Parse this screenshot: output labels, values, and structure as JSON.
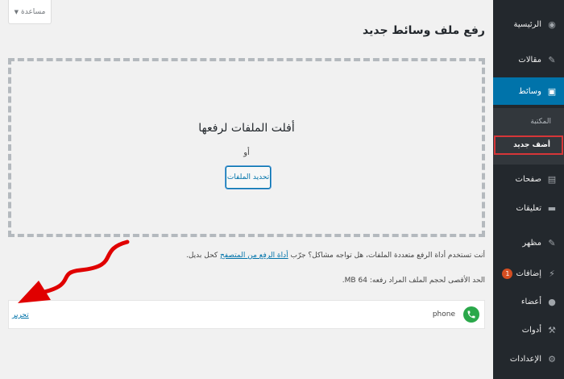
{
  "help": {
    "label": "مساعدة"
  },
  "page": {
    "title": "رفع ملف وسائط جديد"
  },
  "uploader": {
    "drop_title": "أفلت الملفات لرفعها",
    "or_text": "أو",
    "select_button": "تحديد الملفات"
  },
  "note": {
    "prefix": "أنت تستخدم أداة الرفع متعددة الملفات، هل تواجه مشاكل؟ جرّب ",
    "link": "أداة الرفع من المتصفح",
    "suffix": " كحل بديل."
  },
  "max_size": {
    "text": "الحد الأقصى لحجم الملف المراد رفعه: 64 MB."
  },
  "media_item": {
    "filename": "phone",
    "edit_label": "تحرير"
  },
  "sidebar": {
    "items": [
      {
        "label": "الرئيسية",
        "icon": "dashboard-icon"
      },
      {
        "label": "مقالات",
        "icon": "pin-icon"
      },
      {
        "label": "وسائط",
        "icon": "media-icon"
      },
      {
        "label": "صفحات",
        "icon": "pages-icon"
      },
      {
        "label": "تعليقات",
        "icon": "comments-icon"
      },
      {
        "label": "مظهر",
        "icon": "appearance-icon"
      },
      {
        "label": "إضافات",
        "icon": "plugins-icon",
        "badge": "1"
      },
      {
        "label": "أعضاء",
        "icon": "users-icon"
      },
      {
        "label": "أدوات",
        "icon": "tools-icon"
      },
      {
        "label": "الإعدادات",
        "icon": "settings-icon"
      }
    ],
    "submenu": [
      {
        "label": "المكتبة"
      },
      {
        "label": "أضف جديد"
      }
    ]
  },
  "colors": {
    "sidebar_bg": "#23282d",
    "active_bg": "#0073aa",
    "link": "#0073aa",
    "highlight_border": "#d63638",
    "annotation_arrow": "#e00000",
    "phone_icon_bg": "#2aa84a"
  }
}
